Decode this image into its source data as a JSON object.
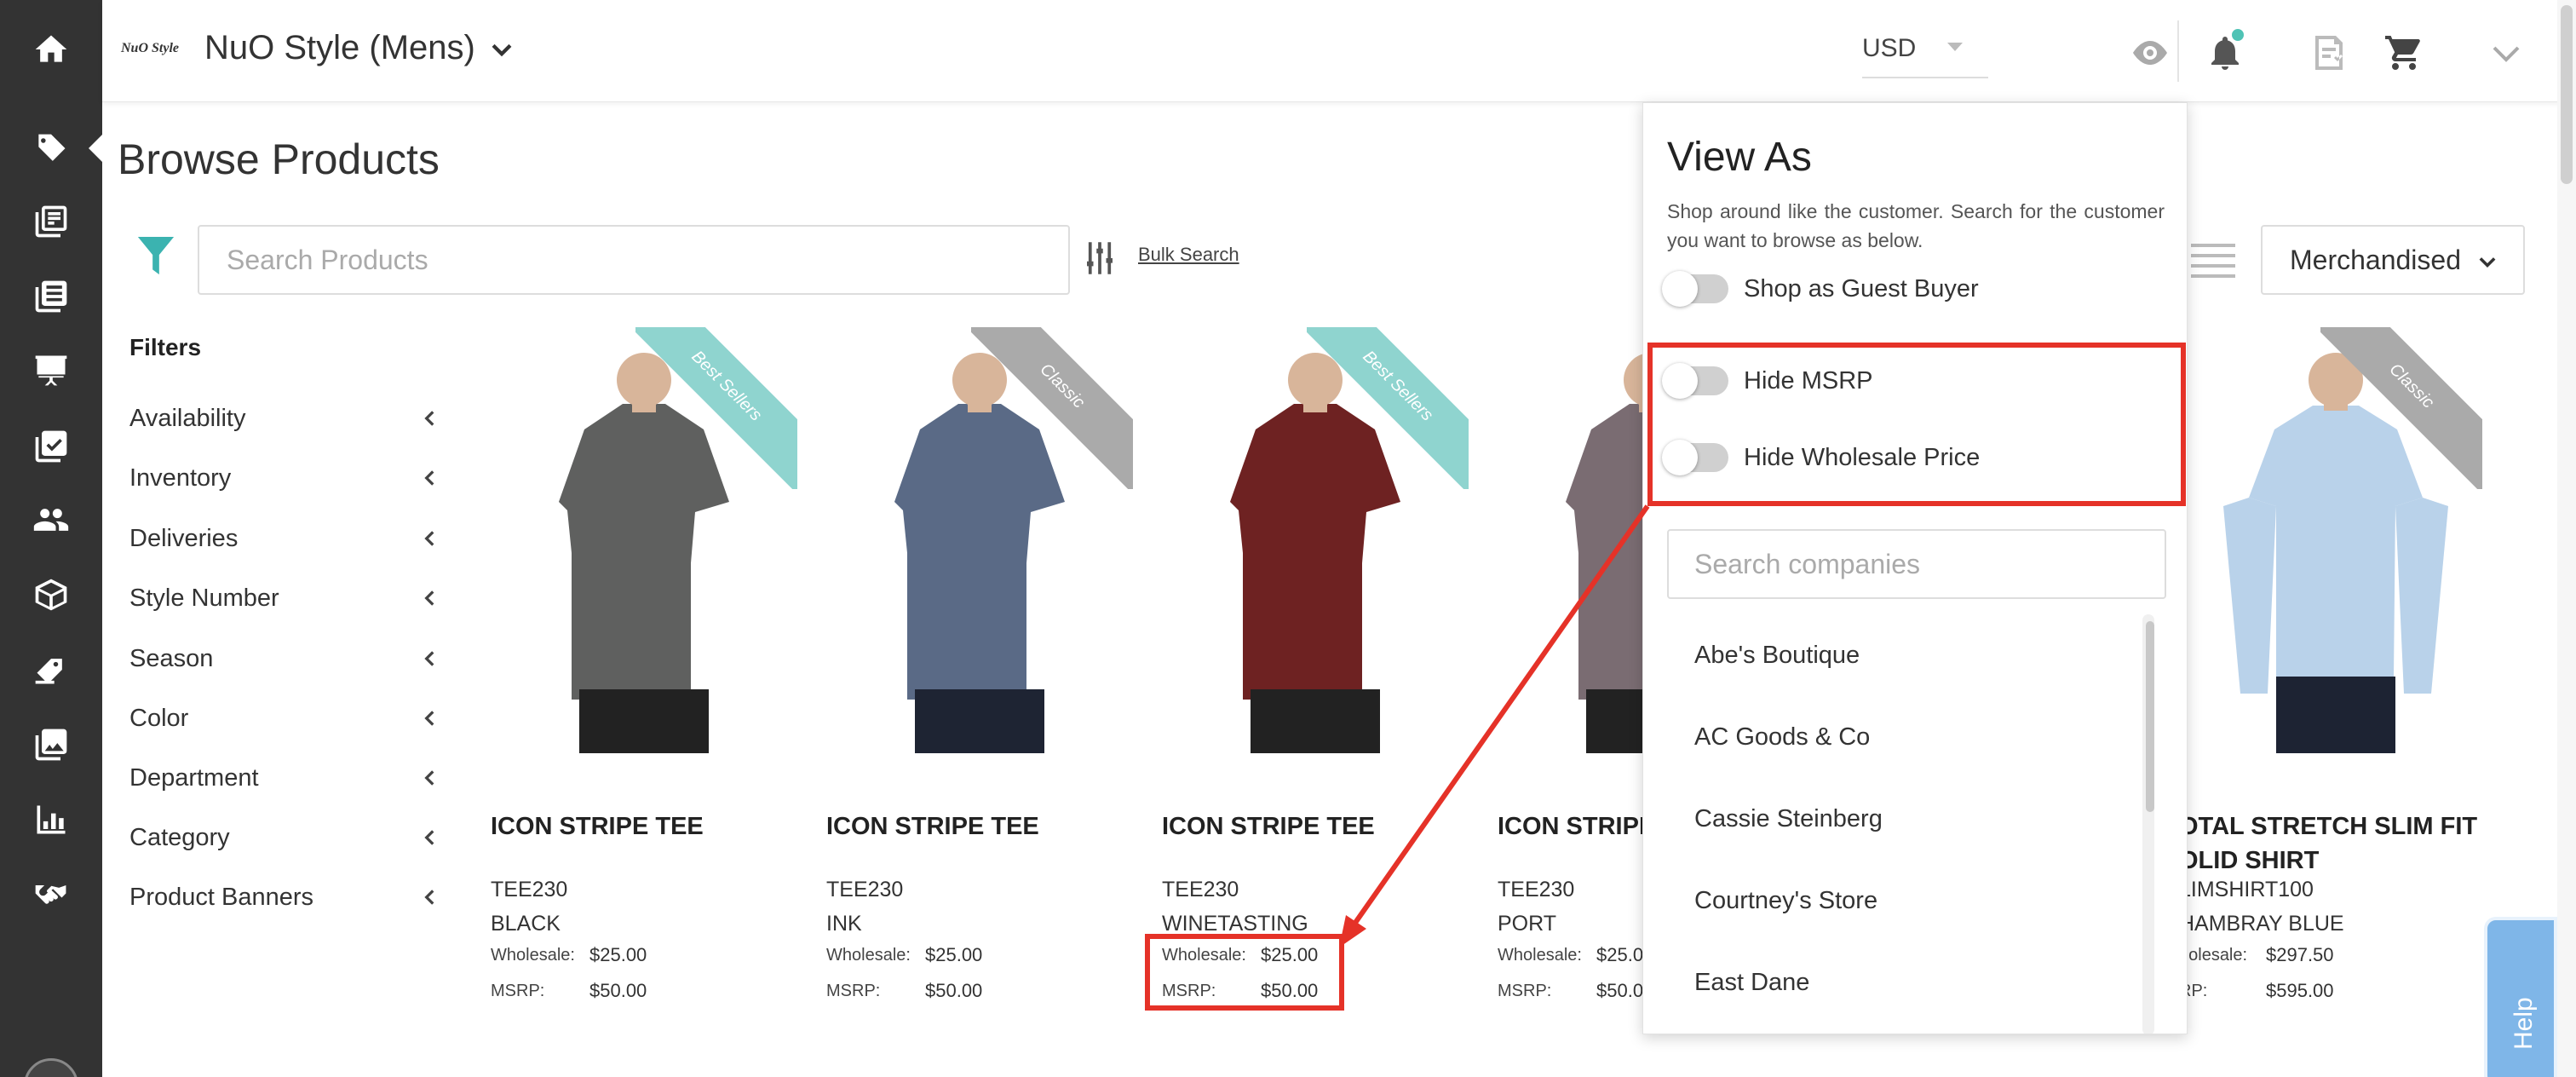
{
  "header": {
    "logo": "NuO Style",
    "store_name": "NuO Style (Mens)",
    "currency": "USD"
  },
  "page": {
    "title": "Browse Products"
  },
  "search": {
    "placeholder": "Search Products",
    "bulk_search": "Bulk Search",
    "sort_value": "Merchandised"
  },
  "filters": {
    "title": "Filters",
    "items": [
      "Availability",
      "Inventory",
      "Deliveries",
      "Style Number",
      "Season",
      "Color",
      "Department",
      "Category",
      "Product Banners"
    ]
  },
  "products": [
    {
      "name": "ICON STRIPE TEE",
      "sku": "TEE230",
      "color": "BLACK",
      "wholesale_label": "Wholesale:",
      "wholesale": "$25.00",
      "msrp_label": "MSRP:",
      "msrp": "$50.00",
      "ribbon": "Best Sellers",
      "shirt_color": "#5f605f"
    },
    {
      "name": "ICON STRIPE TEE",
      "sku": "TEE230",
      "color": "INK",
      "wholesale_label": "Wholesale:",
      "wholesale": "$25.00",
      "msrp_label": "MSRP:",
      "msrp": "$50.00",
      "ribbon": "Classic",
      "shirt_color": "#5a6a86"
    },
    {
      "name": "ICON STRIPE TEE",
      "sku": "TEE230",
      "color": "WINETASTING",
      "wholesale_label": "Wholesale:",
      "wholesale": "$25.00",
      "msrp_label": "MSRP:",
      "msrp": "$50.00",
      "ribbon": "Best Sellers",
      "shirt_color": "#6e2222"
    },
    {
      "name": "ICON STRIPE",
      "sku": "TEE230",
      "color": "PORT",
      "wholesale_label": "Wholesale:",
      "wholesale": "$25.0",
      "msrp_label": "MSRP:",
      "msrp": "$50.0",
      "ribbon": "",
      "shirt_color": "#7a6c72"
    },
    {
      "name": "OTAL STRETCH SLIM FIT OLID SHIRT",
      "sku": "LIMSHIRT100",
      "color": "HAMBRAY BLUE",
      "wholesale_label": "holesale:",
      "wholesale": "$297.50",
      "msrp_label": "RP:",
      "msrp": "$595.00",
      "ribbon": "Classic",
      "shirt_color": "#b9d2ea"
    }
  ],
  "view_as": {
    "title": "View As",
    "description": "Shop around like the customer. Search for the customer you want to browse as below.",
    "toggles": {
      "guest": "Shop as Guest Buyer",
      "hide_msrp": "Hide MSRP",
      "hide_wholesale": "Hide Wholesale Price"
    },
    "company_search_placeholder": "Search companies",
    "companies": [
      "Abe's Boutique",
      "AC Goods & Co",
      "Cassie Steinberg",
      "Courtney's Store",
      "East Dane"
    ]
  },
  "help": {
    "label": "Help"
  },
  "colors": {
    "rail": "#333333",
    "accent_teal": "#4fc3b5",
    "highlight_red": "#e53228",
    "ribbon_best": "#8fd4cf",
    "ribbon_classic": "#aaaaaa"
  }
}
